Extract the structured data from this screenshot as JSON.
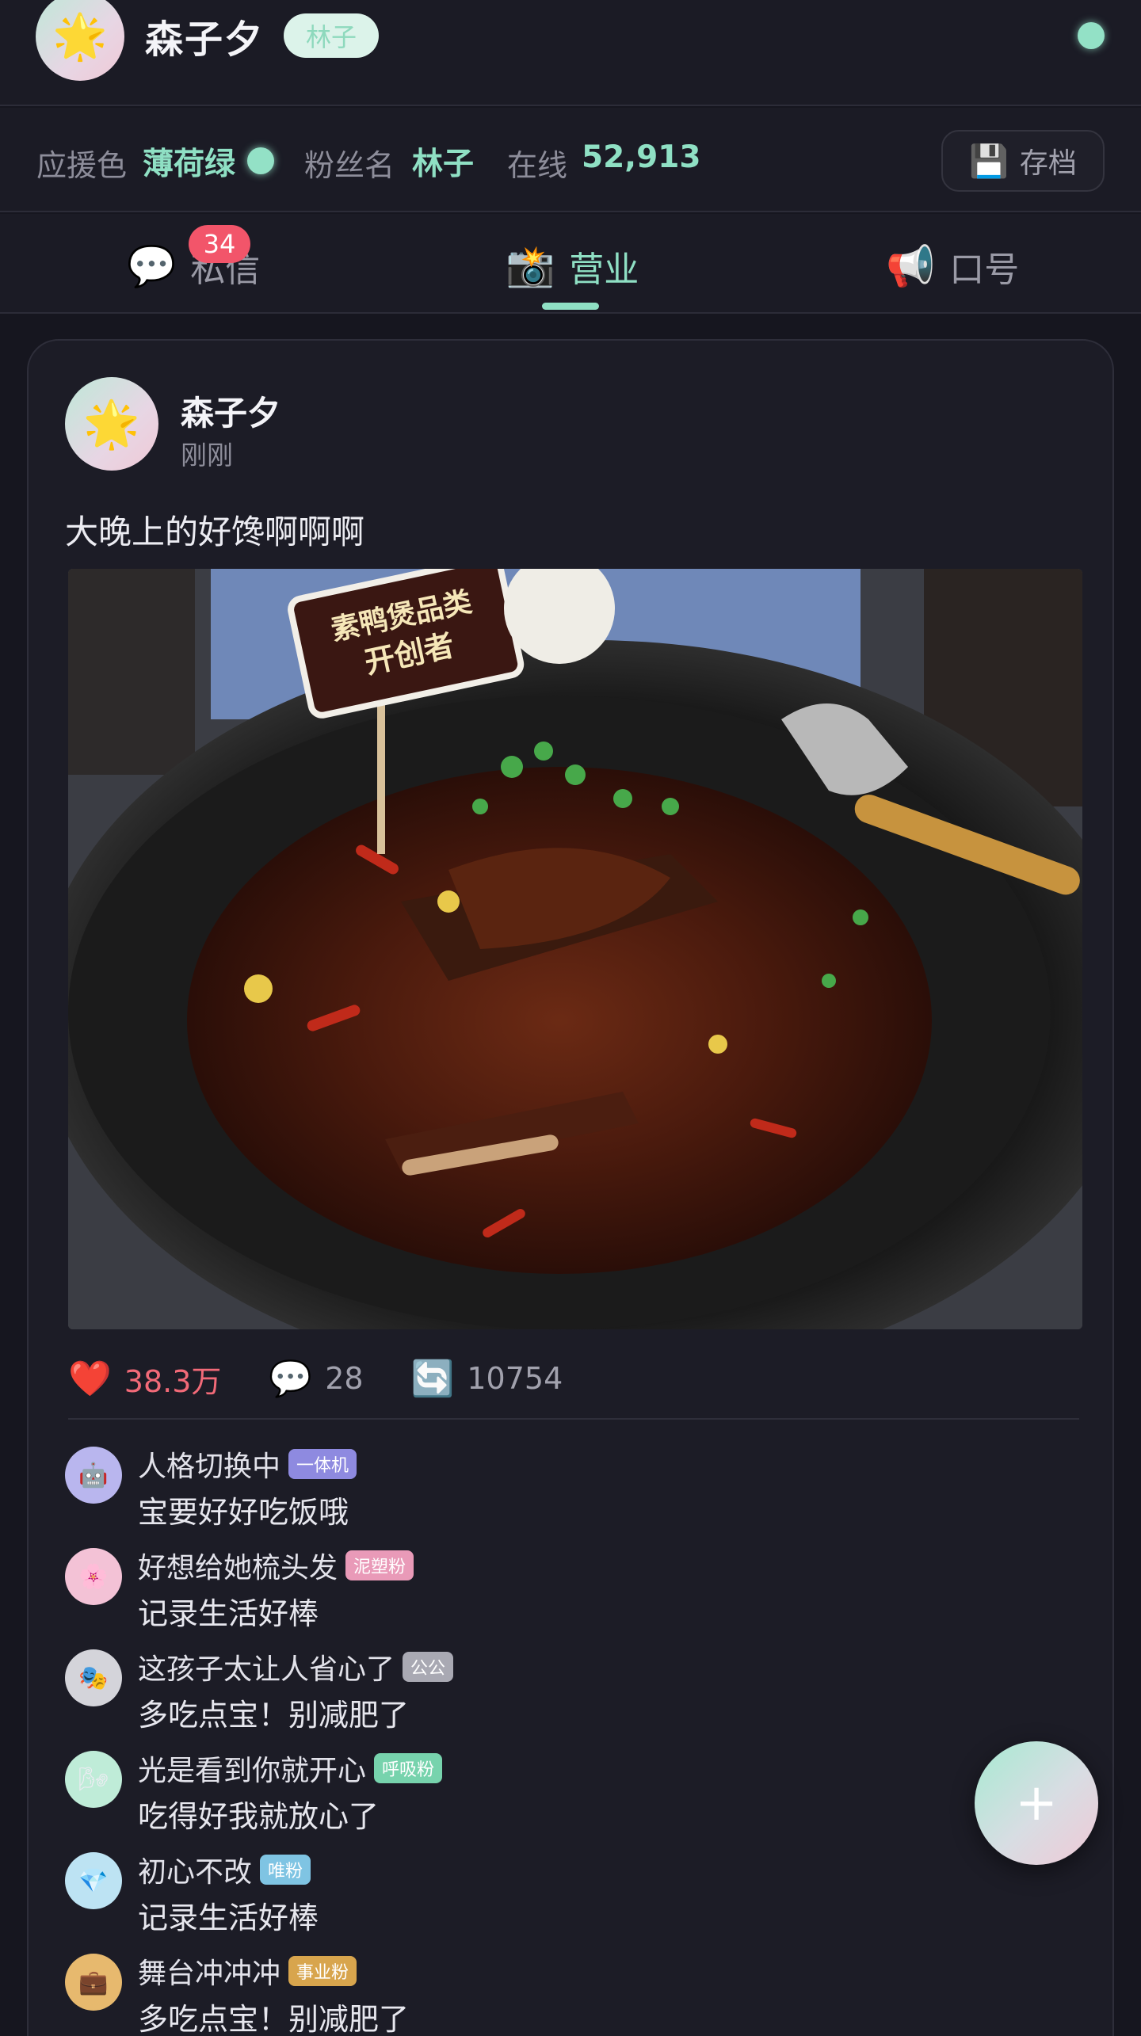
{
  "header": {
    "avatar_emoji": "🌟",
    "name": "森子夕",
    "tag": "林子",
    "status_color": "#93e1c6"
  },
  "infobar": {
    "support_color_label": "应援色",
    "support_color_value": "薄荷绿",
    "fan_name_label": "粉丝名",
    "fan_name_value": "林子",
    "online_label": "在线",
    "online_value": "52,913",
    "save_icon": "💾",
    "save_label": "存档"
  },
  "tabs": [
    {
      "icon": "💬",
      "label": "私信",
      "badge": "34"
    },
    {
      "icon": "📸",
      "label": "营业"
    },
    {
      "icon": "📢",
      "label": "口号"
    }
  ],
  "post": {
    "avatar_emoji": "🌟",
    "author": "森子夕",
    "time": "刚刚",
    "text": "大晚上的好馋啊啊啊",
    "image_sign_line1": "素鸭煲品类",
    "image_sign_line2": "开创者",
    "likes_icon": "❤️",
    "likes": "38.3万",
    "comments_icon": "💬",
    "comments_count": "28",
    "reposts_icon": "🔄",
    "reposts": "10754"
  },
  "comments": [
    {
      "avatar": "🤖",
      "avatar_bg": "#b9b6ee",
      "name": "人格切换中",
      "tag": "一体机",
      "tag_color": "#8e8ae0",
      "text": "宝要好好吃饭哦"
    },
    {
      "avatar": "🌸",
      "avatar_bg": "#f3c2d6",
      "name": "好想给她梳头发",
      "tag": "泥塑粉",
      "tag_color": "#e99ab8",
      "text": "记录生活好棒"
    },
    {
      "avatar": "🎭",
      "avatar_bg": "#d4d4da",
      "name": "这孩子太让人省心了",
      "tag": "公公",
      "tag_color": "#a9a9b3",
      "text": "多吃点宝！别减肥了"
    },
    {
      "avatar": "🌬",
      "avatar_bg": "#bfecd8",
      "name": "光是看到你就开心",
      "tag": "呼吸粉",
      "tag_color": "#77d3ad",
      "text": "吃得好我就放心了"
    },
    {
      "avatar": "💎",
      "avatar_bg": "#bde3f3",
      "name": "初心不改",
      "tag": "唯粉",
      "tag_color": "#7fc4e3",
      "text": "记录生活好棒"
    },
    {
      "avatar": "💼",
      "avatar_bg": "#e7b96e",
      "name": "舞台冲冲冲",
      "tag": "事业粉",
      "tag_color": "#d8a54d",
      "text": "多吃点宝！别减肥了"
    }
  ],
  "fab": {
    "label": "+"
  }
}
